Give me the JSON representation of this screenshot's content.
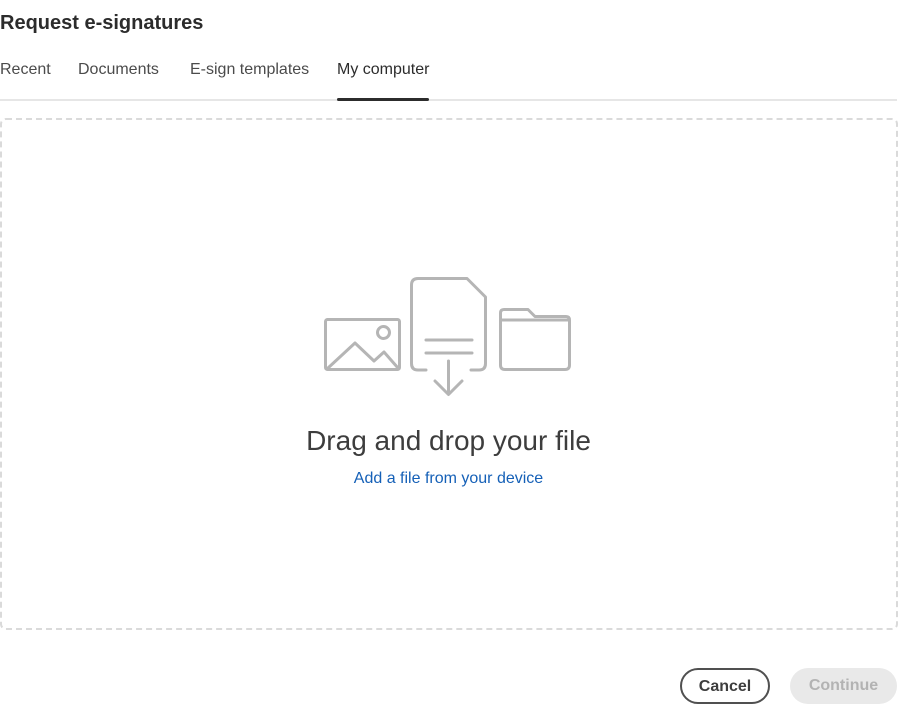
{
  "dialog": {
    "title": "Request e-signatures"
  },
  "tabs": [
    {
      "label": "Recent"
    },
    {
      "label": "Documents"
    },
    {
      "label": "E-sign templates"
    },
    {
      "label": "My computer",
      "selected": true
    }
  ],
  "dropzone": {
    "title": "Drag and drop your file",
    "link_label": "Add a file from your device",
    "icons": [
      "image-icon",
      "document-download-icon",
      "folder-icon"
    ]
  },
  "footer": {
    "cancel_label": "Cancel",
    "continue_label": "Continue",
    "continue_disabled": true
  },
  "colors": {
    "link": "#1560b7",
    "icon_gray": "#b5b5b5",
    "active_tab_indicator": "#2c2c2c",
    "disabled_button_bg": "#e9e9e9"
  }
}
